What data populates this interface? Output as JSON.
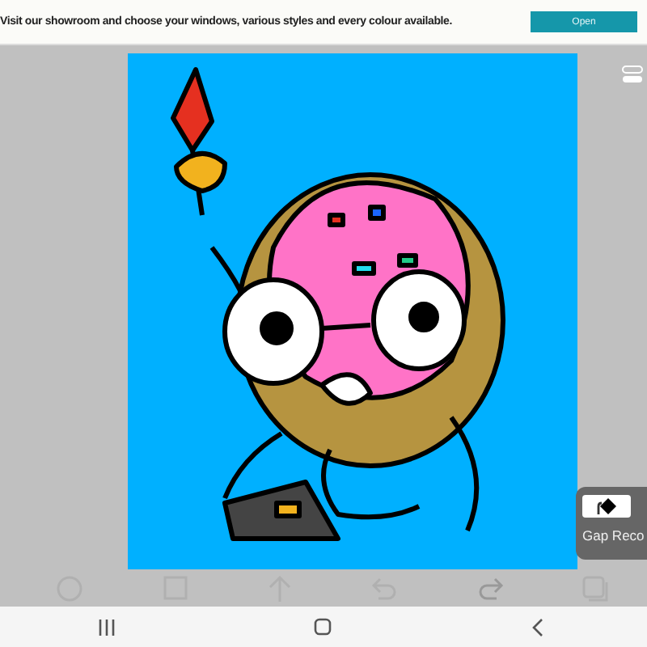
{
  "ad_banner": {
    "text": "Visit our showroom and choose your windows, various styles and every colour available.",
    "button": "Open"
  },
  "toolbar": [
    {
      "kind": "circle",
      "disabled": true
    },
    {
      "kind": "square",
      "disabled": true
    },
    {
      "kind": "up-arrow",
      "disabled": true
    },
    {
      "kind": "undo",
      "disabled": true
    },
    {
      "kind": "redo",
      "disabled": false
    },
    {
      "kind": "layers",
      "disabled": true
    }
  ],
  "gap_popup": {
    "label": "Gap Reco"
  },
  "nav_bar": [
    {
      "kind": "recents"
    },
    {
      "kind": "home"
    },
    {
      "kind": "back"
    }
  ]
}
